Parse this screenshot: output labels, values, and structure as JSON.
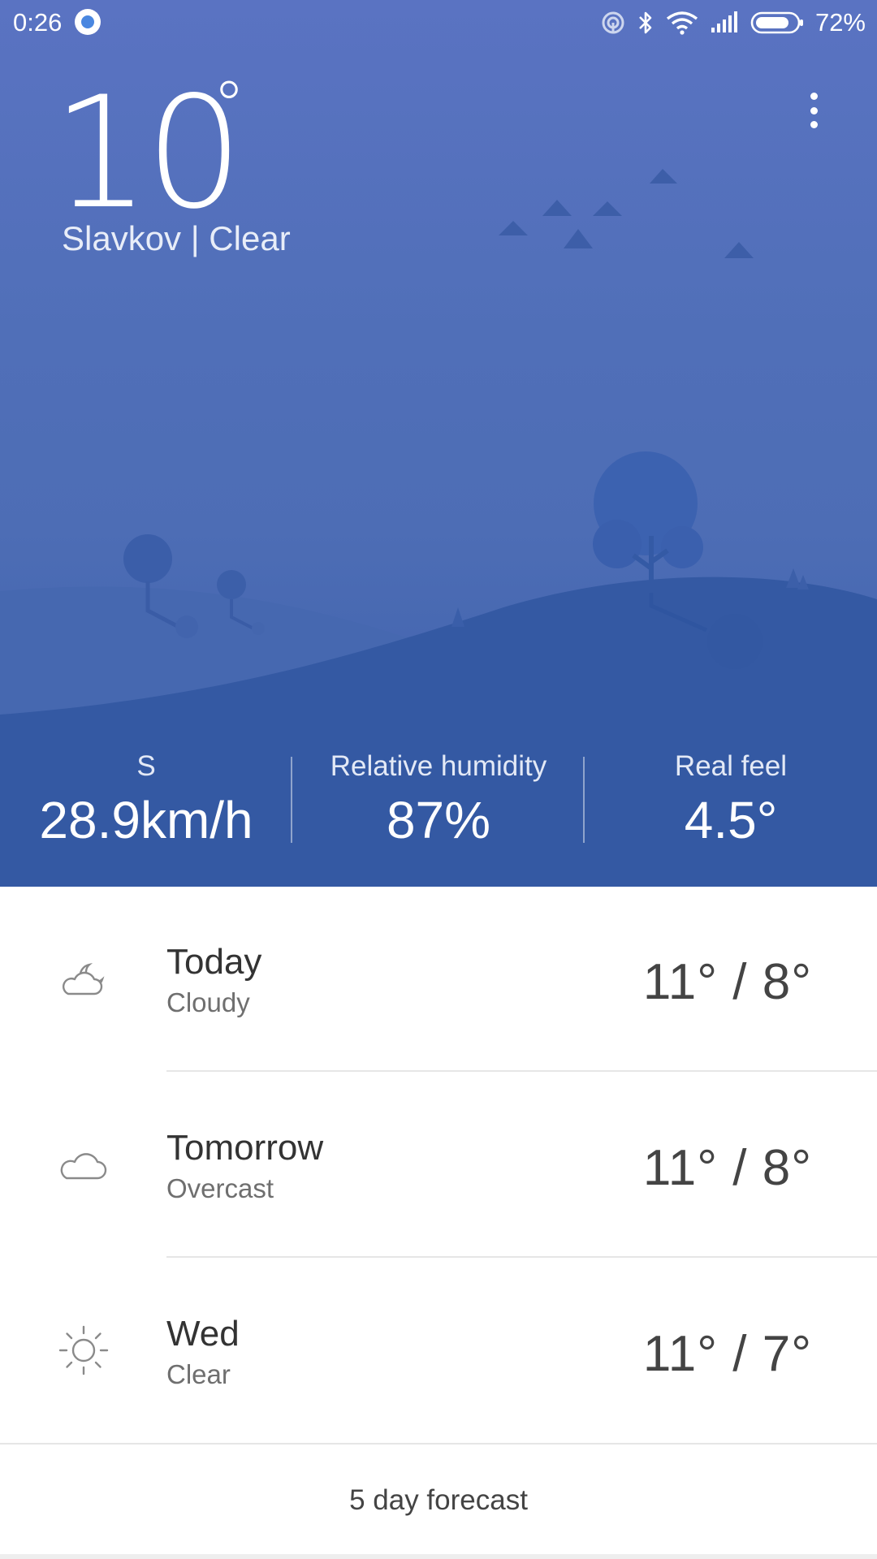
{
  "status_bar": {
    "time": "0:26",
    "battery_percent": "72%",
    "icons": [
      "app-notification-icon",
      "hotspot-icon",
      "bluetooth-icon",
      "wifi-icon",
      "signal-icon",
      "battery-icon"
    ]
  },
  "current": {
    "temperature": "10",
    "degree_symbol": "°",
    "location_condition": "Slavkov | Clear"
  },
  "stats": {
    "wind_direction": "S",
    "wind_speed": "28.9km/h",
    "humidity_label": "Relative humidity",
    "humidity_value": "87%",
    "real_feel_label": "Real feel",
    "real_feel_value": "4.5°"
  },
  "forecast": [
    {
      "day": "Today",
      "condition": "Cloudy",
      "temps": "11° / 8°",
      "icon": "cloudy-night-icon"
    },
    {
      "day": "Tomorrow",
      "condition": "Overcast",
      "temps": "11° / 8°",
      "icon": "cloud-icon"
    },
    {
      "day": "Wed",
      "condition": "Clear",
      "temps": "11° / 7°",
      "icon": "sun-icon"
    }
  ],
  "five_day_label": "5 day forecast",
  "colors": {
    "hero_top": "#5a73c2",
    "hero_bottom": "#3a5da9",
    "hill_dark": "#3459a3",
    "hill_light": "#4668b0"
  }
}
